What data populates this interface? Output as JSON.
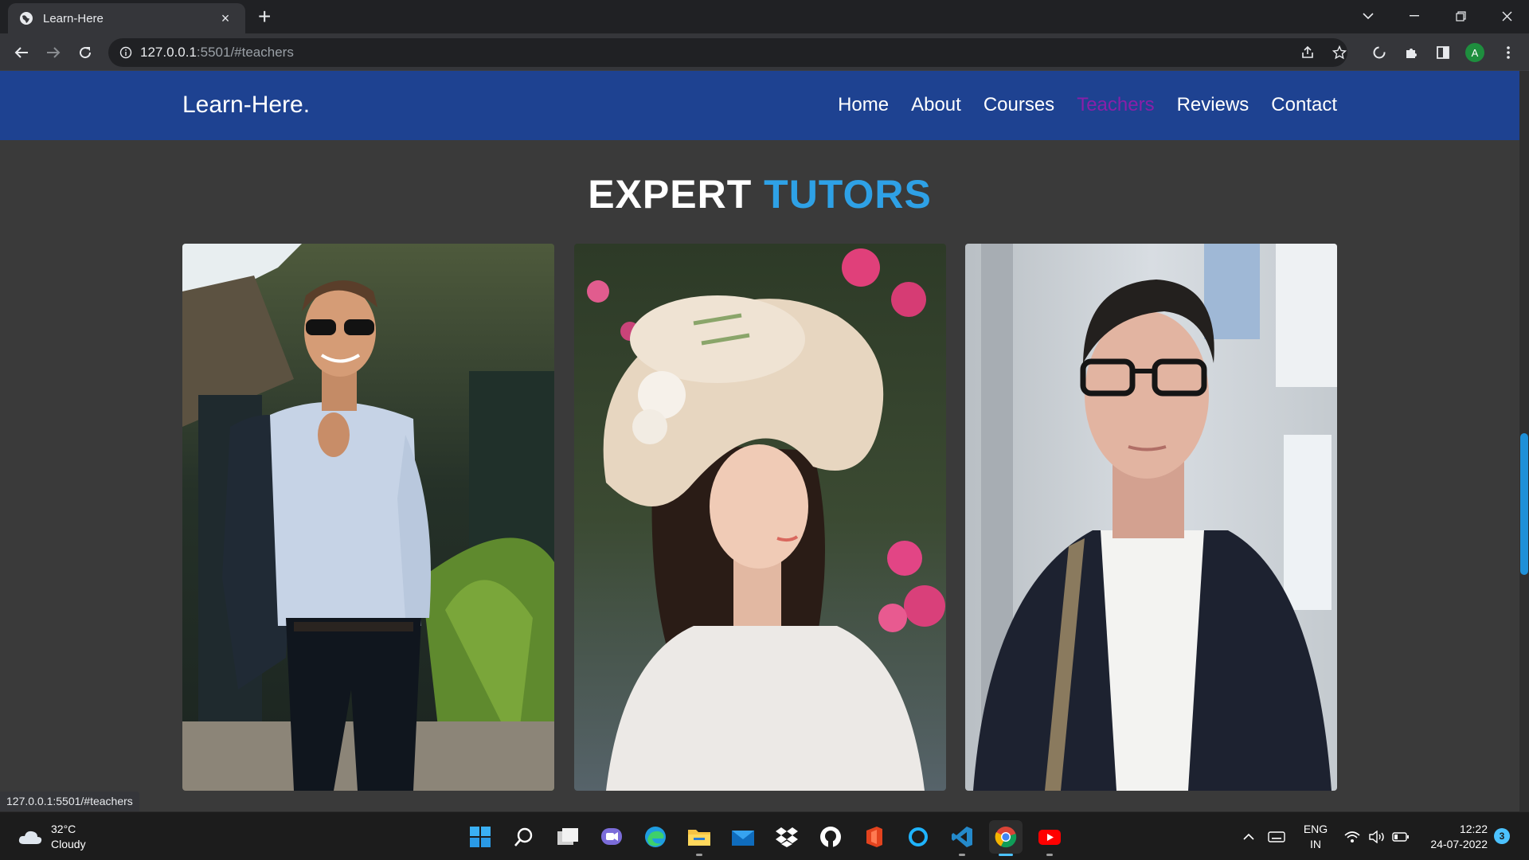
{
  "browser": {
    "tab_title": "Learn-Here",
    "tab_close": "×",
    "new_tab": "+",
    "url_host": "127.0.0.1",
    "url_path": ":5501/#teachers",
    "profile_initial": "A",
    "status_url": "127.0.0.1:5501/#teachers"
  },
  "site": {
    "brand": "Learn-Here.",
    "nav": [
      "Home",
      "About",
      "Courses",
      "Teachers",
      "Reviews",
      "Contact"
    ],
    "active_nav": "Teachers",
    "accent_color": "#2ea1e6",
    "nav_bg": "#1e4291"
  },
  "section": {
    "title_part1": "EXPERT",
    "title_part2": "TUTORS"
  },
  "tutors": [
    {
      "photo": "man-sunglasses-light-blue-shirt"
    },
    {
      "photo": "woman-straw-hat-white-blouse"
    },
    {
      "photo": "man-glasses-navy-blazer"
    }
  ],
  "taskbar": {
    "weather_temp": "32°C",
    "weather_desc": "Cloudy",
    "lang_line1": "ENG",
    "lang_line2": "IN",
    "time": "12:22",
    "date": "24-07-2022",
    "notification_count": "3",
    "apps": [
      "start-icon",
      "search-icon",
      "task-view-icon",
      "teams-chat-icon",
      "edge-icon",
      "file-explorer-icon",
      "mail-icon",
      "dropbox-icon",
      "github-icon",
      "office-icon",
      "cortana-icon",
      "vscode-icon",
      "chrome-icon",
      "youtube-icon"
    ]
  }
}
